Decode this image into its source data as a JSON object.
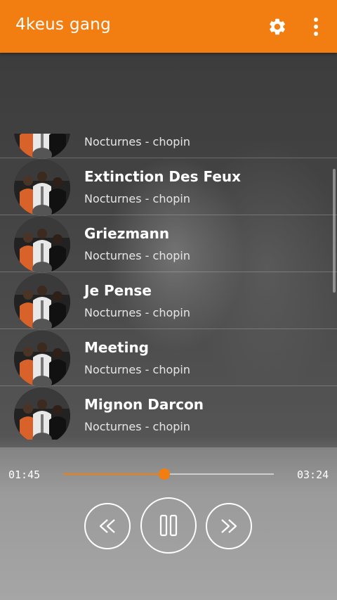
{
  "app": {
    "title": "4keus gang"
  },
  "icons": {
    "settings": "gear-icon",
    "overflow": "more-vert-icon",
    "prev": "rewind-icon",
    "pause": "pause-icon",
    "next": "fast-forward-icon"
  },
  "colors": {
    "accent": "#f27d10",
    "text": "#ffffff"
  },
  "songs": [
    {
      "title": "",
      "subtitle": "Nocturnes - chopin"
    },
    {
      "title": "Extinction Des Feux",
      "subtitle": "Nocturnes - chopin"
    },
    {
      "title": "Griezmann",
      "subtitle": "Nocturnes - chopin"
    },
    {
      "title": "Je Pense",
      "subtitle": "Nocturnes - chopin"
    },
    {
      "title": "Meeting",
      "subtitle": "Nocturnes - chopin"
    },
    {
      "title": "Mignon Darcon",
      "subtitle": "Nocturnes - chopin"
    }
  ],
  "player": {
    "current_time": "01:45",
    "total_time": "03:24",
    "progress": 0.48
  }
}
